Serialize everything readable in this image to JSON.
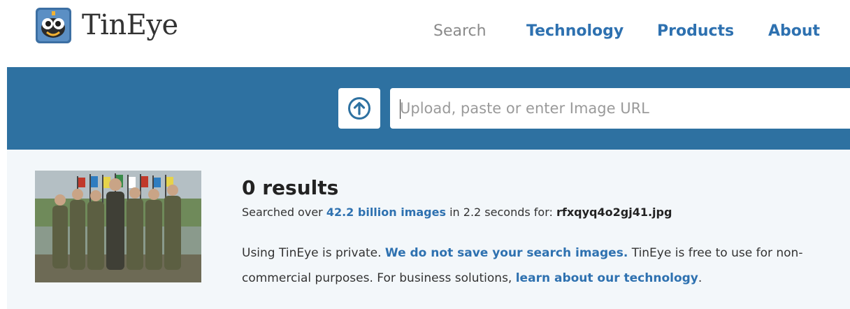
{
  "brand": {
    "name": "TinEye"
  },
  "nav": {
    "search": "Search",
    "technology": "Technology",
    "products": "Products",
    "about": "About"
  },
  "search": {
    "upload_icon": "arrow-up-circle-icon",
    "placeholder": "Upload, paste or enter Image URL"
  },
  "results": {
    "title": "0 results",
    "searched_prefix": "Searched over",
    "image_count": "42.2 billion images",
    "searched_mid": "in 2.2 seconds for:",
    "filename": "rfxqyq4o2gj41.jpg",
    "privacy_prefix": "Using TinEye is private.",
    "privacy_link": "We do not save your search images.",
    "privacy_suffix": "TinEye is free to use for non-commercial purposes. For business solutions,",
    "tech_link": "learn about our technology",
    "tech_suffix": "."
  },
  "colors": {
    "accent": "#2e71b0",
    "searchbar": "#2e71a1",
    "results_bg": "#f3f7fa"
  }
}
